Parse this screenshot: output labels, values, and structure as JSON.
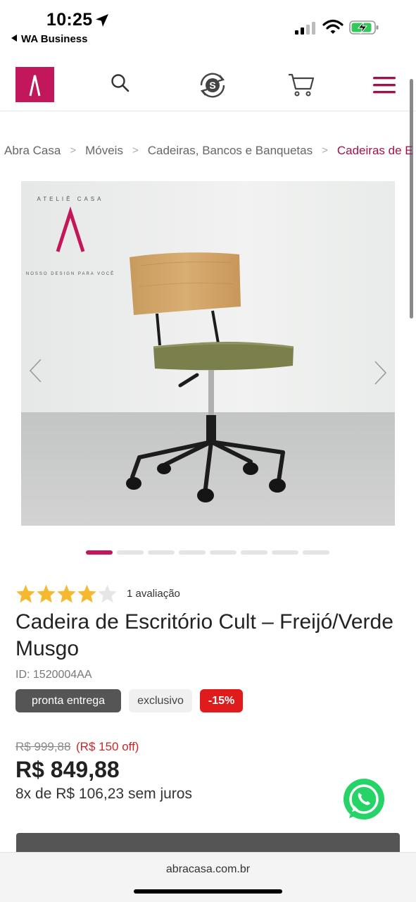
{
  "status_bar": {
    "time": "10:25",
    "back_app": "WA Business",
    "battery_state": "charging"
  },
  "header": {
    "logo_letter": "Λ",
    "icons": [
      "search-icon",
      "shop-s-icon",
      "cart-icon",
      "menu-icon"
    ],
    "brand_color": "#c2185b"
  },
  "breadcrumb": {
    "items": [
      "Abra Casa",
      "Móveis",
      "Cadeiras, Bancos e Banquetas",
      "Cadeiras de Es"
    ]
  },
  "product_image": {
    "stamp_arc_top": "ATELIÊ CASA",
    "stamp_arc_bottom": "NOSSO DESIGN PARA VOCÊ",
    "carousel_total": 8,
    "carousel_active": 1
  },
  "product": {
    "rating_stars": 4,
    "rating_max": 5,
    "rating_text": "1 avaliação",
    "title": "Cadeira de Escritório Cult – Freijó/Verde Musgo",
    "id_text": "ID: 1520004AA",
    "tags": {
      "stock": "pronta entrega",
      "exclusive": "exclusivo",
      "discount": "-15%"
    },
    "old_price": "R$ 999,88",
    "discount_amount": "(R$ 150 off)",
    "price": "R$ 849,88",
    "installments": "8x de R$ 106,23 sem juros"
  },
  "browser": {
    "url": "abracasa.com.br"
  },
  "colors": {
    "accent": "#c2185b",
    "star": "#f5b82e",
    "discount_red": "#e01b1b",
    "whatsapp_green": "#25d366"
  }
}
